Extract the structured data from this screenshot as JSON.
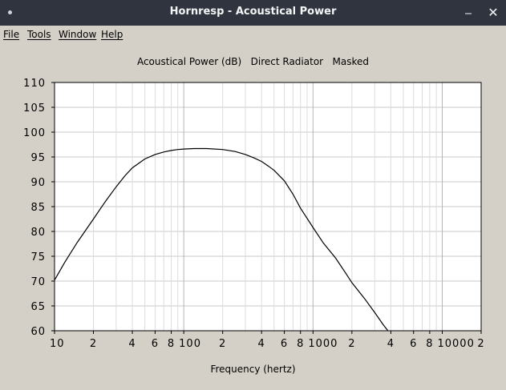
{
  "window": {
    "title": "Hornresp - Acoustical Power",
    "minimize_glyph": "⎯",
    "close_glyph": "✕",
    "menu_icon": "window-menu-dot-icon"
  },
  "menu": {
    "items": [
      {
        "label": "File",
        "name": "menu-file"
      },
      {
        "label": "Tools",
        "name": "menu-tools"
      },
      {
        "label": "Window",
        "name": "menu-window"
      },
      {
        "label": "Help",
        "name": "menu-help"
      }
    ]
  },
  "chart_data": {
    "type": "line",
    "title": "Acoustical Power (dB)   Direct Radiator   Masked",
    "xlabel": "Frequency (hertz)",
    "ylabel": "",
    "xscale": "log",
    "xlim": [
      10,
      20000
    ],
    "ylim": [
      60,
      110
    ],
    "ytick_labels": [
      "110",
      "105",
      "100",
      "95",
      "90",
      "85",
      "80",
      "75",
      "70",
      "65",
      "60"
    ],
    "ytick_values": [
      110,
      105,
      100,
      95,
      90,
      85,
      80,
      75,
      70,
      65,
      60
    ],
    "xtick_labels": [
      {
        "value": 10,
        "label": "10"
      },
      {
        "value": 20,
        "label": "2"
      },
      {
        "value": 40,
        "label": "4"
      },
      {
        "value": 60,
        "label": "6"
      },
      {
        "value": 80,
        "label": "8"
      },
      {
        "value": 100,
        "label": "100"
      },
      {
        "value": 200,
        "label": "2"
      },
      {
        "value": 400,
        "label": "4"
      },
      {
        "value": 600,
        "label": "6"
      },
      {
        "value": 800,
        "label": "8"
      },
      {
        "value": 1000,
        "label": "1000"
      },
      {
        "value": 2000,
        "label": "2"
      },
      {
        "value": 4000,
        "label": "4"
      },
      {
        "value": 6000,
        "label": "6"
      },
      {
        "value": 8000,
        "label": "8"
      },
      {
        "value": 10000,
        "label": "10000"
      },
      {
        "value": 20000,
        "label": "2"
      }
    ],
    "grid": true,
    "series": [
      {
        "x": [
          10,
          12,
          15,
          20,
          25,
          30,
          35,
          40,
          50,
          60,
          70,
          80,
          90,
          100,
          120,
          150,
          200,
          250,
          300,
          350,
          400,
          450,
          500,
          600,
          700,
          800,
          1000,
          1200,
          1500,
          1800,
          2000,
          2500,
          3000,
          3500,
          3800
        ],
        "y": [
          70.2,
          73.8,
          77.8,
          82.5,
          86.2,
          89.0,
          91.2,
          92.8,
          94.6,
          95.5,
          96.0,
          96.3,
          96.5,
          96.6,
          96.7,
          96.7,
          96.5,
          96.1,
          95.5,
          94.8,
          94.1,
          93.2,
          92.3,
          90.2,
          87.5,
          84.7,
          80.8,
          77.7,
          74.6,
          71.5,
          69.7,
          66.5,
          63.7,
          61.2,
          60.0
        ]
      }
    ]
  }
}
